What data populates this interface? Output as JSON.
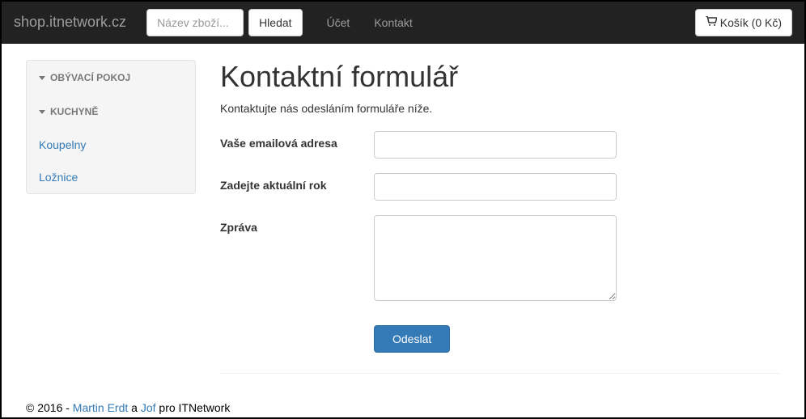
{
  "navbar": {
    "brand": "shop.itnetwork.cz",
    "search_placeholder": "Název zboží...",
    "search_button": "Hledat",
    "links": {
      "account": "Účet",
      "contact": "Kontakt"
    },
    "cart_label": "Košík (0 Kč)"
  },
  "sidebar": {
    "categories": [
      {
        "label": "OBÝVACÍ POKOJ"
      },
      {
        "label": "KUCHYNĚ"
      }
    ],
    "links": [
      {
        "label": "Koupelny"
      },
      {
        "label": "Ložnice"
      }
    ]
  },
  "main": {
    "title": "Kontaktní formulář",
    "subtitle": "Kontaktujte nás odesláním formuláře níže.",
    "fields": {
      "email_label": "Vaše emailová adresa",
      "year_label": "Zadejte aktuální rok",
      "message_label": "Zpráva"
    },
    "submit_label": "Odeslat"
  },
  "footer": {
    "prefix": "© 2016 - ",
    "author1": "Martin Erdt",
    "mid": " a ",
    "author2": "Jof",
    "suffix": " pro ITNetwork"
  }
}
